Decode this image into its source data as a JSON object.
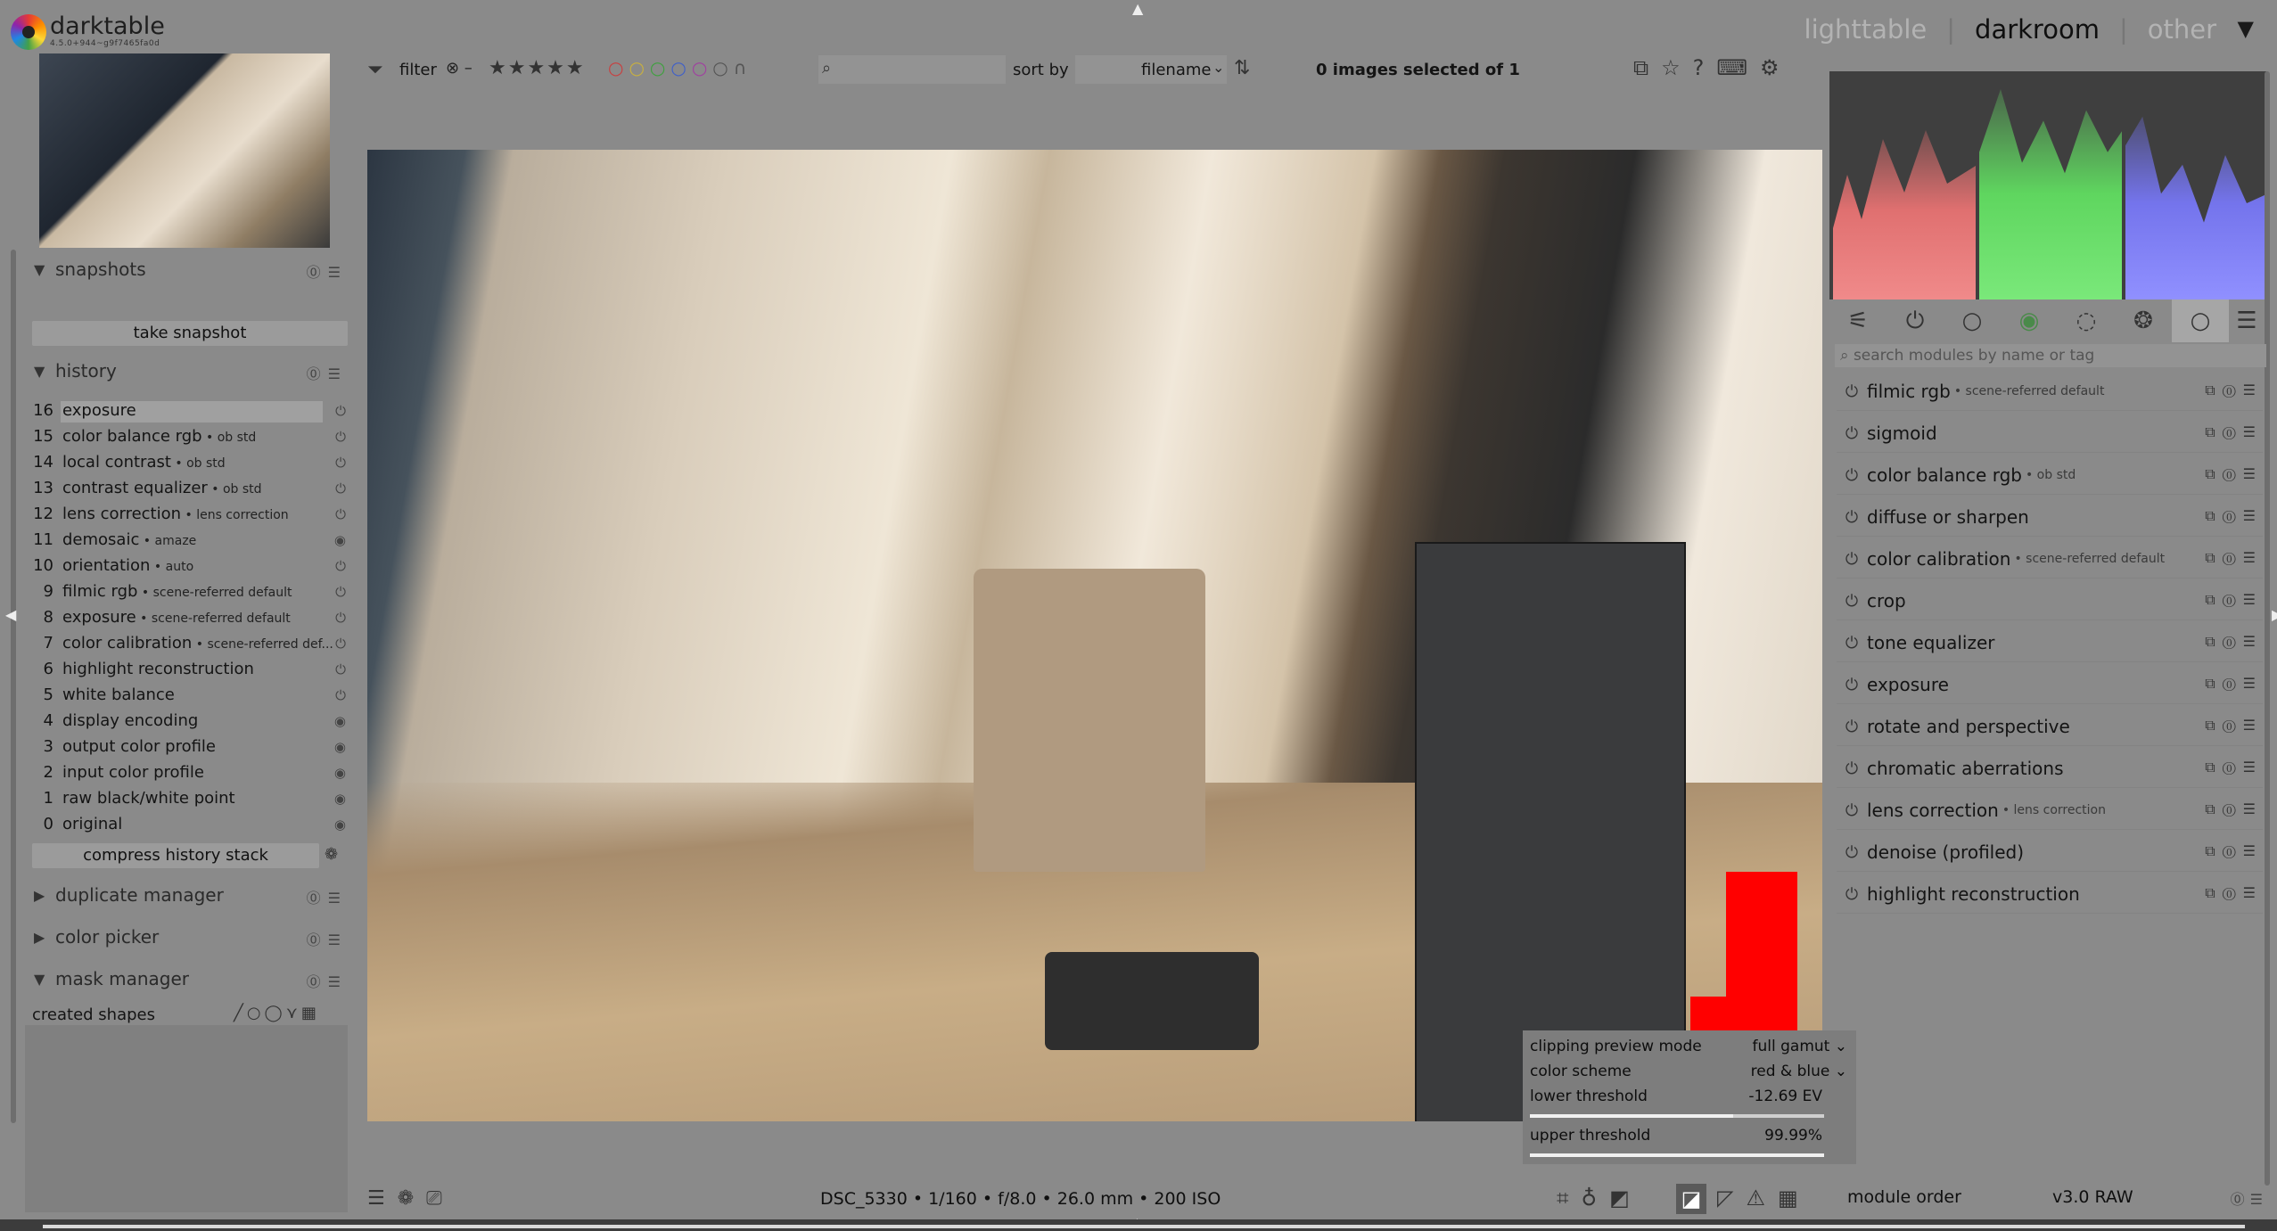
{
  "app": {
    "name": "darktable",
    "version": "4.5.0+944~g9f7465fa0d"
  },
  "views": {
    "lighttable": "lighttable",
    "darkroom": "darkroom",
    "other": "other",
    "sep": "|"
  },
  "filterbar": {
    "filter_label": "filter",
    "stars": "★★★★★",
    "sort_label": "sort by",
    "sort_value": "filename",
    "selection_status": "0 images selected of 1"
  },
  "snapshots": {
    "title": "snapshots",
    "take_button": "take snapshot"
  },
  "history": {
    "title": "history",
    "items": [
      {
        "num": "16",
        "label": "exposure",
        "sub": ""
      },
      {
        "num": "15",
        "label": "color balance rgb",
        "sub": " • ob std"
      },
      {
        "num": "14",
        "label": "local contrast",
        "sub": " • ob std"
      },
      {
        "num": "13",
        "label": "contrast equalizer",
        "sub": " • ob std"
      },
      {
        "num": "12",
        "label": "lens correction",
        "sub": " • lens correction"
      },
      {
        "num": "11",
        "label": "demosaic",
        "sub": " • amaze"
      },
      {
        "num": "10",
        "label": "orientation",
        "sub": " • auto"
      },
      {
        "num": "9",
        "label": "filmic rgb",
        "sub": " • scene-referred default"
      },
      {
        "num": "8",
        "label": "exposure",
        "sub": " • scene-referred default"
      },
      {
        "num": "7",
        "label": "color calibration",
        "sub": " • scene-referred def..."
      },
      {
        "num": "6",
        "label": "highlight reconstruction",
        "sub": ""
      },
      {
        "num": "5",
        "label": "white balance",
        "sub": ""
      },
      {
        "num": "4",
        "label": "display encoding",
        "sub": ""
      },
      {
        "num": "3",
        "label": "output color profile",
        "sub": ""
      },
      {
        "num": "2",
        "label": "input color profile",
        "sub": ""
      },
      {
        "num": "1",
        "label": "raw black/white point",
        "sub": ""
      },
      {
        "num": "0",
        "label": "original",
        "sub": ""
      }
    ],
    "compress_button": "compress history stack"
  },
  "left_modules": {
    "duplicate": "duplicate manager",
    "color_picker": "color picker",
    "mask_manager": "mask manager",
    "created_shapes": "created shapes"
  },
  "clipping": {
    "mode_label": "clipping preview mode",
    "mode_value": "full gamut",
    "scheme_label": "color scheme",
    "scheme_value": "red & blue",
    "lower_label": "lower threshold",
    "lower_value": "-12.69 EV",
    "lower_fraction": 0.69,
    "upper_label": "upper threshold",
    "upper_value": "99.99%",
    "upper_fraction": 0.9999
  },
  "image_info": "DSC_5330  • 1/160 • f/8.0 • 26.0 mm • 200 ISO",
  "module_search_placeholder": "search modules by name or tag",
  "active_modules": [
    {
      "label": "filmic rgb",
      "sub": "• scene-referred default"
    },
    {
      "label": "sigmoid",
      "sub": ""
    },
    {
      "label": "color balance rgb",
      "sub": "• ob std"
    },
    {
      "label": "diffuse or sharpen",
      "sub": ""
    },
    {
      "label": "color calibration",
      "sub": "• scene-referred default"
    },
    {
      "label": "crop",
      "sub": ""
    },
    {
      "label": "tone equalizer",
      "sub": ""
    },
    {
      "label": "exposure",
      "sub": ""
    },
    {
      "label": "rotate and perspective",
      "sub": ""
    },
    {
      "label": "chromatic aberrations",
      "sub": ""
    },
    {
      "label": "lens correction",
      "sub": "• lens correction"
    },
    {
      "label": "denoise (profiled)",
      "sub": ""
    },
    {
      "label": "highlight reconstruction",
      "sub": ""
    }
  ],
  "module_order": {
    "label": "module order",
    "value": "v3.0 RAW"
  }
}
